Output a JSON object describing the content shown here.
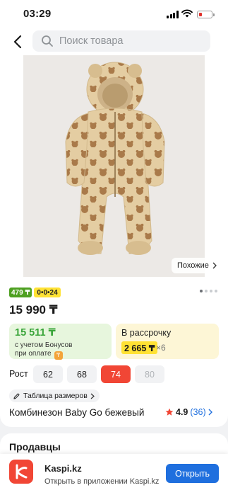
{
  "status_bar": {
    "time": "03:29"
  },
  "search": {
    "placeholder": "Поиск товара"
  },
  "gallery": {
    "similar_label": "Похожие",
    "page_count": 4,
    "active_page": 1
  },
  "badges": {
    "bonus_badge": "479 ₸",
    "installment_badge": "0•0•24"
  },
  "price": "15 990 ₸",
  "bonus": {
    "amount": "15 511 ₸",
    "text_line1": "с учетом Бонусов",
    "text_line2": "при оплате"
  },
  "installment": {
    "label": "В рассрочку",
    "amount": "2 665 ₸",
    "multiplier": "×6"
  },
  "sizes": {
    "label": "Рост",
    "options": [
      {
        "value": "62",
        "state": "available"
      },
      {
        "value": "68",
        "state": "available"
      },
      {
        "value": "74",
        "state": "selected"
      },
      {
        "value": "80",
        "state": "disabled"
      }
    ]
  },
  "size_table": {
    "label": "Таблица размеров"
  },
  "product": {
    "title": "Комбинезон Baby Go бежевый",
    "rating": "4.9",
    "reviews": "(36)"
  },
  "sellers": {
    "title": "Продавцы"
  },
  "banner": {
    "app_name": "Kaspi.kz",
    "subtitle": "Открыть в приложении Kaspi.kz",
    "open_label": "Открыть"
  },
  "colors": {
    "accent_red": "#f14635",
    "bonus_green": "#4ea021",
    "link_blue": "#1f6fde",
    "highlight_yellow": "#ffe234"
  }
}
